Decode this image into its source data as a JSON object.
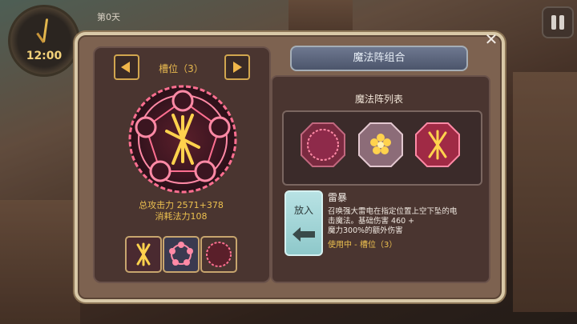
{
  "hud": {
    "clock_time": "12:00",
    "day_label": "第0天"
  },
  "left_panel": {
    "slot_label": "槽位（3）",
    "attack_line": "总攻击力 2571+378",
    "mana_line": "消耗法力108"
  },
  "right_panel": {
    "header": "魔法阵组合",
    "list_title": "魔法阵列表",
    "put_button": "放入",
    "spell": {
      "name": "雷暴",
      "desc_line1": "召唤强大雷电在指定位置上空下坠的电",
      "desc_line2": "击魔法。基础伤害 460 +",
      "desc_line3": "魔力300%的额外伤害",
      "status": "使用中 - 槽位（3）"
    }
  },
  "colors": {
    "accent_gold": "#ecc04f",
    "panel_frame": "#d9c9a8",
    "rune_pink": "#ff6f91"
  }
}
